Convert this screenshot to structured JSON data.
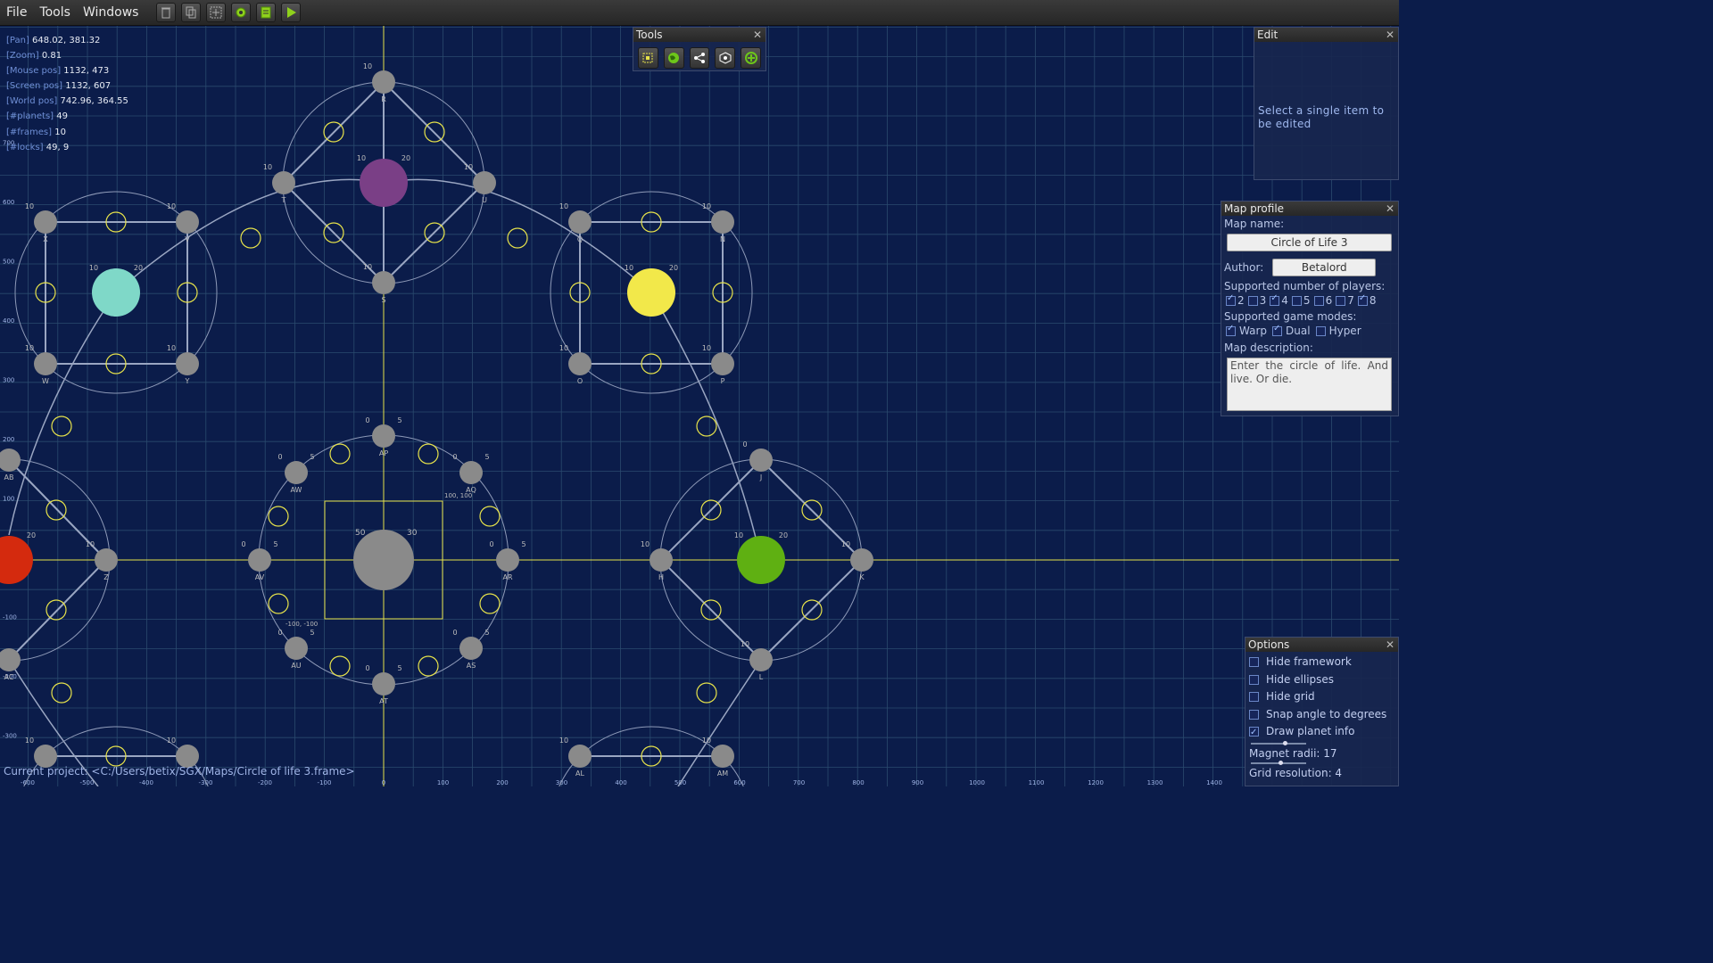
{
  "menu": [
    "File",
    "Tools",
    "Windows"
  ],
  "toolbar_icons": [
    "trash-icon",
    "copy-icon",
    "grid-select-icon",
    "gear-icon",
    "document-icon",
    "play-icon"
  ],
  "info": [
    {
      "key": "[Pan]",
      "value": "648.02, 381.32"
    },
    {
      "key": "[Zoom]",
      "value": "0.81"
    },
    {
      "key": "[Mouse pos]",
      "value": "1132, 473"
    },
    {
      "key": "[Screen pos]",
      "value": "1132, 607"
    },
    {
      "key": "[World pos]",
      "value": "742.96, 364.55"
    },
    {
      "key": "[#planets]",
      "value": "49"
    },
    {
      "key": "[#frames]",
      "value": "10"
    },
    {
      "key": "[#locks]",
      "value": "49, 9"
    }
  ],
  "tools_panel": {
    "title": "Tools",
    "icons": [
      "select-icon",
      "planet-icon",
      "link-icon",
      "frame-icon",
      "add-icon"
    ]
  },
  "edit_panel": {
    "title": "Edit",
    "message": "Select a single item to be edited"
  },
  "map_profile": {
    "title": "Map profile",
    "map_name_label": "Map name:",
    "map_name": "Circle of Life 3",
    "author_label": "Author:",
    "author": "Betalord",
    "players_label": "Supported number of players:",
    "players": [
      {
        "n": "2",
        "checked": true
      },
      {
        "n": "3",
        "checked": false
      },
      {
        "n": "4",
        "checked": true
      },
      {
        "n": "5",
        "checked": false
      },
      {
        "n": "6",
        "checked": false
      },
      {
        "n": "7",
        "checked": false
      },
      {
        "n": "8",
        "checked": true
      }
    ],
    "modes_label": "Supported game modes:",
    "modes": [
      {
        "name": "Warp",
        "checked": true
      },
      {
        "name": "Dual",
        "checked": true
      },
      {
        "name": "Hyper",
        "checked": false
      }
    ],
    "description_label": "Map description:",
    "description": "Enter the circle of life. And live. Or die."
  },
  "options": {
    "title": "Options",
    "items": [
      {
        "label": "Hide framework",
        "checked": false
      },
      {
        "label": "Hide ellipses",
        "checked": false
      },
      {
        "label": "Hide grid",
        "checked": false
      },
      {
        "label": "Snap angle to degrees",
        "checked": false
      },
      {
        "label": "Draw planet info",
        "checked": true
      }
    ],
    "magnet_label": "Magnet radii: 17",
    "magnet_level": 0.55,
    "grid_label": "Grid resolution: 4",
    "grid_level": 0.5
  },
  "status": "Current project: <C:/Users/betix/SGX/Maps/Circle of life 3.frame>",
  "map": {
    "x_ticks": [
      "-600",
      "-500",
      "-400",
      "-300",
      "-200",
      "-100",
      "0",
      "100",
      "200",
      "300",
      "400",
      "500",
      "600",
      "700",
      "800",
      "900",
      "1000",
      "1100",
      "1200",
      "1300",
      "1400"
    ],
    "y_ticks": [
      "700",
      "600",
      "500",
      "400",
      "300",
      "200",
      "100",
      "-100",
      "-200",
      "-300"
    ],
    "corner_labels": [
      "100, 100",
      "-100, -100"
    ],
    "colors": {
      "purple": "#7a3f86",
      "teal": "#7fd8c8",
      "yellow": "#f2e84a",
      "green": "#5fb012",
      "red": "#d42a0e",
      "gray": "#8a8a8a",
      "axis": "#e6e24a"
    }
  }
}
